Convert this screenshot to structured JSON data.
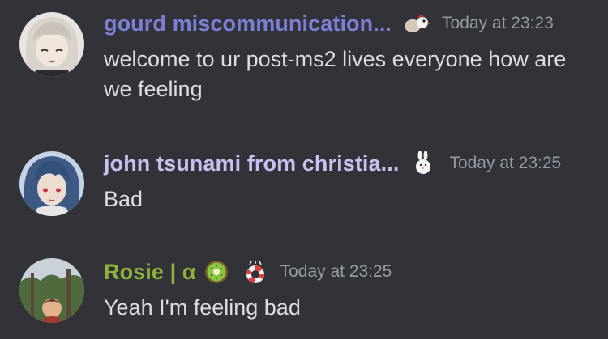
{
  "messages": [
    {
      "username": "gourd miscommunication...",
      "username_color": "#7c7fd6",
      "badge_icon": "bird-emoji-icon",
      "timestamp": "Today at 23:23",
      "content": "welcome to ur post-ms2 lives everyone how are we feeling"
    },
    {
      "username": "john tsunami from christia...",
      "username_color": "#c8c0f0",
      "badge_icon": "rabbit-emoji-icon",
      "timestamp": "Today at 23:25",
      "content": "Bad"
    },
    {
      "username": "Rosie | α",
      "username_color": "#8fb339",
      "name_emoji_icon": "kiwi-emoji-icon",
      "badge_icon": "lifebuoy-emoji-icon",
      "timestamp": "Today at 23:25",
      "content": "Yeah I'm feeling bad"
    }
  ]
}
